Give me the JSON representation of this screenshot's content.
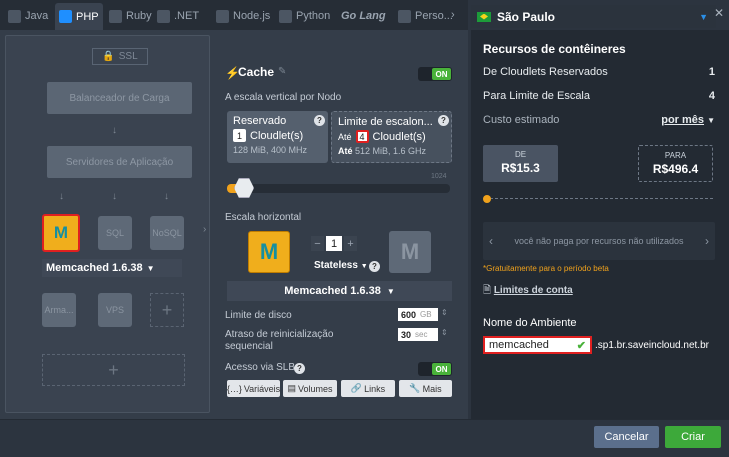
{
  "tabs": [
    "Java",
    "PHP",
    "Ruby",
    ".NET",
    "Node.js",
    "Python",
    "Go Lang",
    "Perso..."
  ],
  "topology": {
    "ssl": "SSL",
    "balancer": "Balanceador de Carga",
    "appservers": "Servidores de Aplicação",
    "nodes": [
      "SQL",
      "NoSQL"
    ],
    "memcached_dropdown": "Memcached 1.6.38",
    "storage": "Arma...",
    "vps": "VPS"
  },
  "cache": {
    "title": "Cache",
    "toggle": "ON",
    "vertical_label": "A escala vertical por Nodo",
    "reserved": {
      "title": "Reservado",
      "count": "1",
      "unit": "Cloudlet(s)",
      "spec": "128 MiB, 400 MHz"
    },
    "limit": {
      "title": "Limite de escalon...",
      "prefix": "Até",
      "count": "4",
      "unit": "Cloudlet(s)",
      "spec_prefix": "Até",
      "spec": "512 MiB, 1.6 GHz"
    },
    "slider_max": "1024",
    "horizontal_label": "Escala horizontal",
    "nodes_count": "1",
    "stateless_label": "Stateless",
    "version_dropdown": "Memcached 1.6.38",
    "disk_label": "Limite de disco",
    "disk_value": "600",
    "disk_unit": "GB",
    "restart_label": "Atraso de reinicialização sequencial",
    "restart_value": "30",
    "restart_unit": "sec",
    "slb_label": "Acesso via SLB",
    "slb_toggle": "ON",
    "buttons": [
      "Variáveis",
      "Volumes",
      "Links",
      "Mais"
    ]
  },
  "region": {
    "name": "São Paulo"
  },
  "resources": {
    "title": "Recursos de contêineres",
    "rows": [
      {
        "label": "De Cloudlets Reservados",
        "value": "1"
      },
      {
        "label": "Para Limite de Escala",
        "value": "4"
      }
    ],
    "cost_label": "Custo estimado",
    "cost_period": "por mês",
    "from_label": "DE",
    "from_value": "R$15.3",
    "to_label": "PARA",
    "to_value": "R$496.4",
    "carousel_text": "você não paga por recursos não utilizados",
    "beta_note": "*Gratuitamente para o período beta",
    "account_limits": "Limites de conta",
    "env_title": "Nome do Ambiente",
    "env_value": "memcached",
    "env_domain": ".sp1.br.saveincloud.net.br"
  },
  "footer": {
    "cancel": "Cancelar",
    "create": "Criar"
  },
  "colors": {
    "accent": "#f0ae1c",
    "green": "#49b23a",
    "highlight": "#e02020",
    "cancel": "#5b6f8c",
    "create": "#3da93a"
  }
}
